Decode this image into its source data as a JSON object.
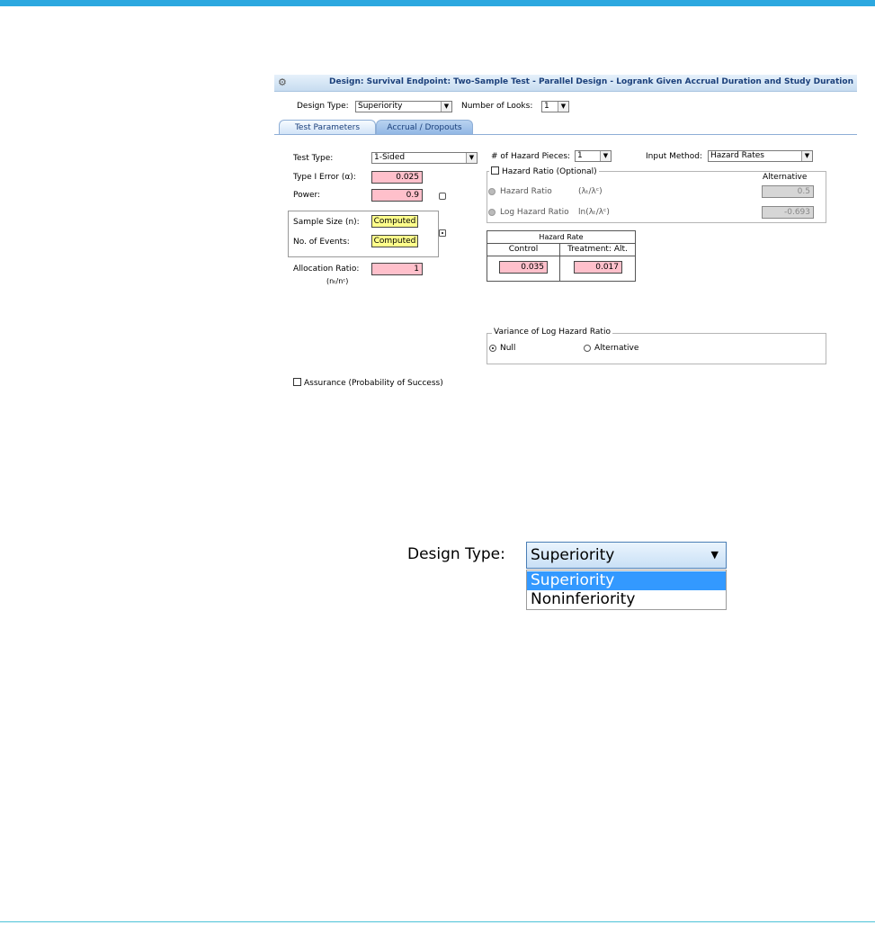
{
  "dialog": {
    "title": "Design: Survival Endpoint: Two-Sample Test - Parallel Design - Logrank Given Accrual Duration and Study Duration",
    "design_type_label": "Design Type:",
    "design_type_value": "Superiority",
    "looks_label": "Number of Looks:",
    "looks_value": "1",
    "tabs": [
      "Test Parameters",
      "Accrual / Dropouts"
    ]
  },
  "params": {
    "test_type_label": "Test Type:",
    "test_type_value": "1-Sided",
    "type1_label": "Type I Error (α):",
    "type1_value": "0.025",
    "power_label": "Power:",
    "power_value": "0.9",
    "sample_size_label": "Sample Size (n):",
    "sample_size_value": "Computed",
    "events_label": "No. of Events:",
    "events_value": "Computed",
    "allocation_label": "Allocation Ratio:",
    "allocation_sub": "(nₜ/nᶜ)",
    "allocation_value": "1",
    "assurance_label": "Assurance (Probability of Success)"
  },
  "hazard": {
    "pieces_label": "# of Hazard Pieces:",
    "pieces_value": "1",
    "input_method_label": "Input Method:",
    "input_method_value": "Hazard Rates",
    "ratio_group_label": "Hazard Ratio (Optional)",
    "alternative_header": "Alternative",
    "hr_label": "Hazard Ratio",
    "hr_formula": "(λₜ/λᶜ)",
    "hr_value": "0.5",
    "lhr_label": "Log Hazard Ratio",
    "lhr_formula": "ln(λₜ/λᶜ)",
    "lhr_value": "-0.693",
    "rate_header": "Hazard Rate",
    "control_header": "Control",
    "treatment_header": "Treatment: Alt.",
    "control_value": "0.035",
    "treatment_value": "0.017"
  },
  "variance": {
    "group_label": "Variance of Log Hazard Ratio",
    "null_label": "Null",
    "alt_label": "Alternative"
  },
  "zoom": {
    "label": "Design Type:",
    "selected": "Superiority",
    "options": [
      "Superiority",
      "Noninferiority"
    ]
  }
}
